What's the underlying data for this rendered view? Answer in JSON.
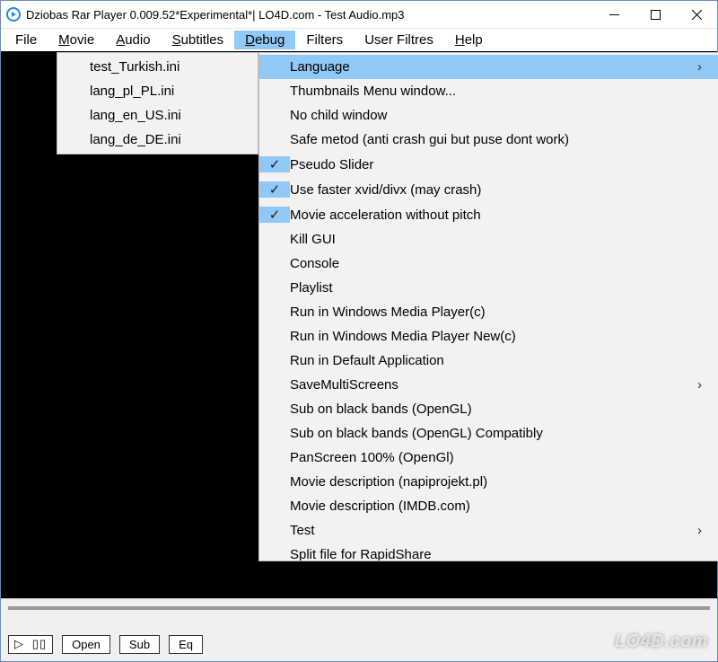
{
  "window": {
    "title": "Dziobas Rar Player 0.009.52*Experimental*| LO4D.com - Test Audio.mp3"
  },
  "menubar": {
    "file": "File",
    "movie_pre": "M",
    "movie_post": "ovie",
    "audio_pre": "A",
    "audio_post": "udio",
    "subtitles_pre": "S",
    "subtitles_post": "ubtitles",
    "debug_pre": "D",
    "debug_post": "ebug",
    "filters": "Filters",
    "userfilters": "User Filtres",
    "help_pre": "H",
    "help_post": "elp"
  },
  "submenu": {
    "items": [
      "test_Turkish.ini",
      "lang_pl_PL.ini",
      "lang_en_US.ini",
      "lang_de_DE.ini"
    ]
  },
  "debugmenu": {
    "items": [
      {
        "label": "Language",
        "checked": false,
        "submenu": true,
        "highlight": true
      },
      {
        "label": "Thumbnails Menu window...",
        "checked": false,
        "submenu": false
      },
      {
        "label": "No child window",
        "checked": false,
        "submenu": false
      },
      {
        "label": "Safe metod (anti crash gui but puse dont work)",
        "checked": false,
        "submenu": false
      },
      {
        "label": "Pseudo Slider",
        "checked": true,
        "submenu": false
      },
      {
        "label": "Use faster xvid/divx (may crash)",
        "checked": true,
        "submenu": false
      },
      {
        "label": "Movie acceleration without pitch",
        "checked": true,
        "submenu": false
      },
      {
        "label": "Kill GUI",
        "checked": false,
        "submenu": false
      },
      {
        "label": "Console",
        "checked": false,
        "submenu": false
      },
      {
        "label": "Playlist",
        "checked": false,
        "submenu": false
      },
      {
        "label": "Run in Windows Media Player(c)",
        "checked": false,
        "submenu": false
      },
      {
        "label": "Run in Windows Media Player New(c)",
        "checked": false,
        "submenu": false
      },
      {
        "label": "Run in Default Application",
        "checked": false,
        "submenu": false
      },
      {
        "label": "SaveMultiScreens",
        "checked": false,
        "submenu": true
      },
      {
        "label": "Sub on black bands (OpenGL)",
        "checked": false,
        "submenu": false
      },
      {
        "label": "Sub on black bands (OpenGL) Compatibly",
        "checked": false,
        "submenu": false
      },
      {
        "label": "PanScreen 100% (OpenGl)",
        "checked": false,
        "submenu": false
      },
      {
        "label": "Movie description (napiprojekt.pl)",
        "checked": false,
        "submenu": false
      },
      {
        "label": "Movie description (IMDB.com)",
        "checked": false,
        "submenu": false
      },
      {
        "label": "Test",
        "checked": false,
        "submenu": true
      }
    ],
    "cutoff": "Split file for RapidShare"
  },
  "controls": {
    "play_icons": "▷ ▯▯",
    "open": "Open",
    "sub": "Sub",
    "eq": "Eq"
  },
  "watermark": "LO4D.com"
}
